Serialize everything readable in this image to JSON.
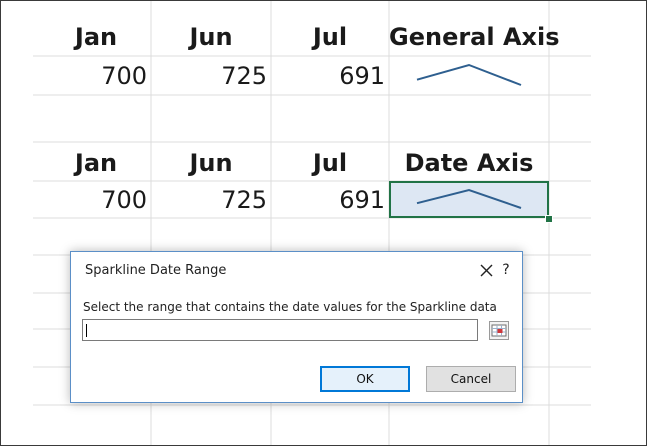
{
  "table1": {
    "headers": [
      "Jan",
      "Jun",
      "Jul",
      "General Axis"
    ],
    "values": [
      "700",
      "725",
      "691"
    ]
  },
  "table2": {
    "headers": [
      "Jan",
      "Jun",
      "Jul",
      "Date Axis"
    ],
    "values": [
      "700",
      "725",
      "691"
    ]
  },
  "sparkline_values": [
    700,
    725,
    691
  ],
  "colors": {
    "sparkline": "#2e5f8f",
    "selection": "#217346",
    "grid": "#dcdcdc",
    "dialog_border": "#5b8fc7"
  },
  "dialog": {
    "title": "Sparkline Date Range",
    "help": "?",
    "label": "Select the range that contains the date values for the Sparkline data",
    "input_value": "",
    "ok": "OK",
    "cancel": "Cancel"
  }
}
